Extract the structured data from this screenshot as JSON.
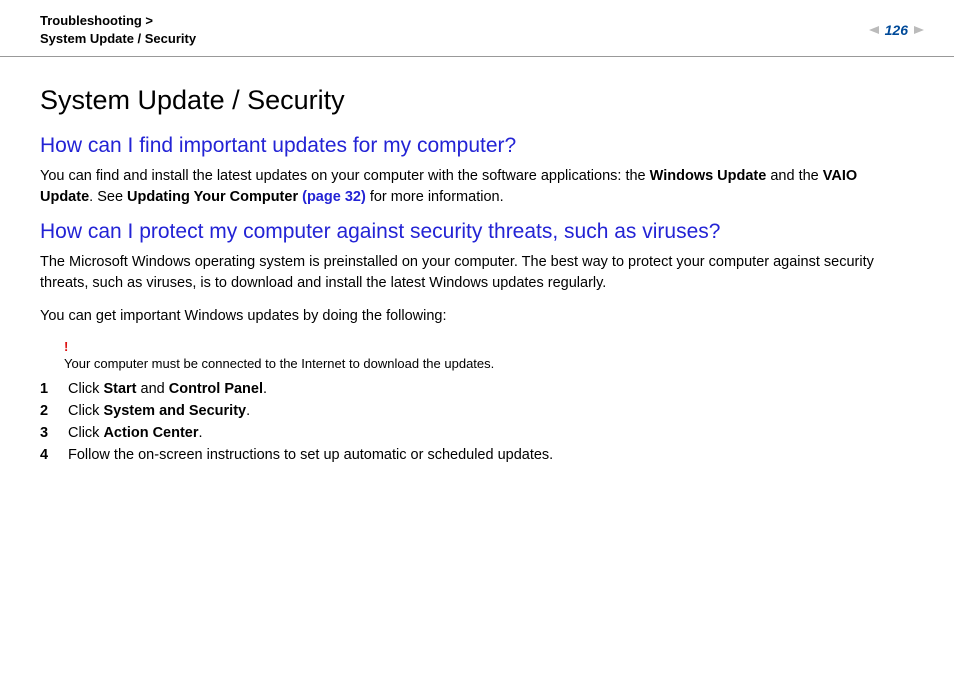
{
  "breadcrumb": {
    "line1": "Troubleshooting >",
    "line2": "System Update / Security"
  },
  "page_number": "126",
  "title": "System Update / Security",
  "section1": {
    "heading": "How can I find important updates for my computer?",
    "p1_a": "You can find and install the latest updates on your computer with the software applications: the ",
    "p1_b1": "Windows Update",
    "p1_c": " and the ",
    "p1_b2": "VAIO Update",
    "p1_d": ". See ",
    "p1_b3": "Updating Your Computer ",
    "p1_link": "(page 32)",
    "p1_e": " for more information."
  },
  "section2": {
    "heading": "How can I protect my computer against security threats, such as viruses?",
    "p1": "The Microsoft Windows operating system is preinstalled on your computer. The best way to protect your computer against security threats, such as viruses, is to download and install the latest Windows updates regularly.",
    "p2": "You can get important Windows updates by doing the following:",
    "note_bang": "!",
    "note": "Your computer must be connected to the Internet to download the updates.",
    "steps": [
      {
        "n": "1",
        "pre": "Click ",
        "b1": "Start",
        "mid": " and ",
        "b2": "Control Panel",
        "post": "."
      },
      {
        "n": "2",
        "pre": "Click ",
        "b1": "System and Security",
        "mid": "",
        "b2": "",
        "post": "."
      },
      {
        "n": "3",
        "pre": "Click ",
        "b1": "Action Center",
        "mid": "",
        "b2": "",
        "post": "."
      },
      {
        "n": "4",
        "pre": "Follow the on-screen instructions to set up automatic or scheduled updates.",
        "b1": "",
        "mid": "",
        "b2": "",
        "post": ""
      }
    ]
  }
}
